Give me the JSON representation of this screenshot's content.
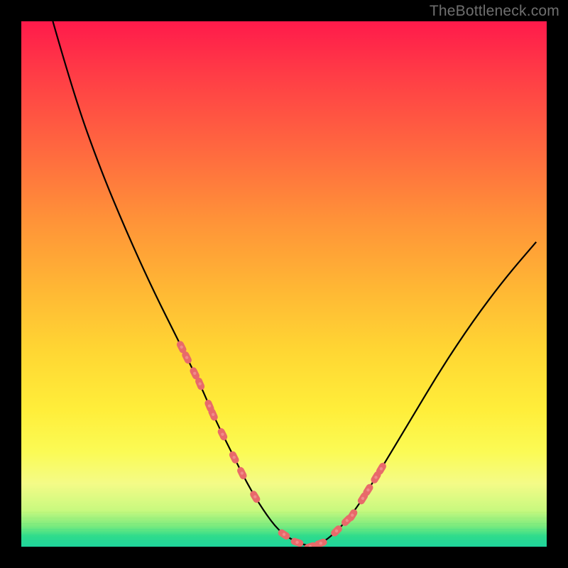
{
  "watermark": "TheBottleneck.com",
  "colors": {
    "curve": "#000000",
    "dots": "#e86a6a",
    "background_black": "#000000"
  },
  "chart_data": {
    "type": "line",
    "title": "",
    "xlabel": "",
    "ylabel": "",
    "xlim": [
      0,
      100
    ],
    "ylim": [
      0,
      100
    ],
    "grid": false,
    "series": [
      {
        "name": "bottleneck-curve",
        "x": [
          6,
          10,
          15,
          20,
          25,
          30,
          34,
          37,
          40,
          43,
          46,
          49,
          52,
          55,
          58,
          63,
          68,
          74,
          80,
          86,
          92,
          98
        ],
        "y": [
          100,
          86,
          72,
          60,
          49,
          39,
          31,
          24,
          18,
          12,
          7,
          3,
          1,
          0,
          1,
          6,
          14,
          24,
          34,
          43,
          51,
          58
        ]
      }
    ],
    "markers": [
      {
        "series": "left-cluster",
        "x": [
          30.5,
          31.5,
          33.0,
          34.0,
          35.8,
          36.5,
          38.3,
          40.5,
          42.0,
          44.5
        ],
        "y_on_curve": true
      },
      {
        "series": "right-cluster",
        "x": [
          60.0,
          62.0,
          63.0,
          65.0,
          66.0,
          67.5,
          68.5
        ],
        "y_on_curve": true
      },
      {
        "series": "bottom",
        "x": [
          50.0,
          52.5,
          55.0,
          57.0
        ],
        "y_on_curve": true
      }
    ],
    "marker_style": {
      "shape": "rounded-pill",
      "color": "#e86a6a",
      "size": 10
    }
  }
}
